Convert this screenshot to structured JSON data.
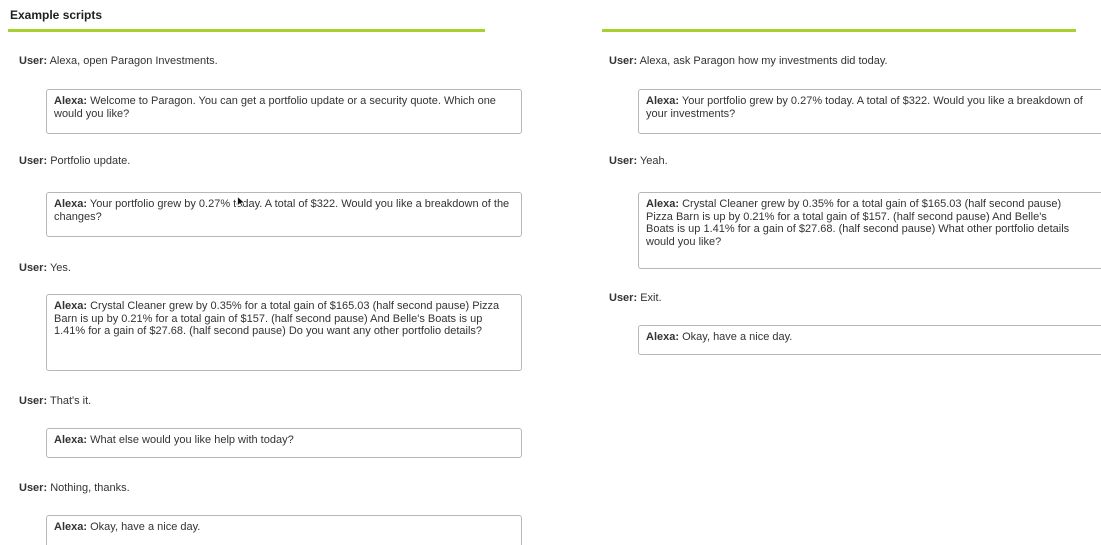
{
  "page": {
    "title": "Example scripts",
    "accent_color": "#a6d12f"
  },
  "left_script": [
    {
      "speaker": "User:",
      "text": "Alexa, open Paragon Investments."
    },
    {
      "speaker": "Alexa:",
      "text": "Welcome to Paragon. You can get a portfolio update or a security quote. Which one would you like?"
    },
    {
      "speaker": "User:",
      "text": "Portfolio update."
    },
    {
      "speaker": "Alexa:",
      "text": "Your portfolio grew by 0.27% today. A total of $322. Would you like a breakdown of the changes?"
    },
    {
      "speaker": "User:",
      "text": "Yes."
    },
    {
      "speaker": "Alexa:",
      "text": "Crystal Cleaner grew by 0.35% for a total gain of $165.03 (half second pause) Pizza Barn is up by 0.21% for a total gain of $157. (half second pause) And Belle's Boats is up 1.41% for a gain of $27.68. (half second pause) Do you want any other portfolio details?"
    },
    {
      "speaker": "User:",
      "text": "That's it."
    },
    {
      "speaker": "Alexa:",
      "text": "What else would you like help with today?"
    },
    {
      "speaker": "User:",
      "text": "Nothing, thanks."
    },
    {
      "speaker": "Alexa:",
      "text": "Okay, have a nice day."
    }
  ],
  "right_script": [
    {
      "speaker": "User:",
      "text": "Alexa, ask Paragon how my investments did today."
    },
    {
      "speaker": "Alexa:",
      "text": "Your portfolio grew by 0.27% today. A total of $322. Would you like a breakdown of your investments?"
    },
    {
      "speaker": "User:",
      "text": "Yeah."
    },
    {
      "speaker": "Alexa:",
      "text": "Crystal Cleaner grew by 0.35% for a total gain of $165.03 (half second pause) Pizza Barn is up by 0.21% for a total gain of $157. (half second pause) And Belle's Boats is up 1.41% for a gain of $27.68. (half second pause) What other portfolio details would you like?"
    },
    {
      "speaker": "User:",
      "text": "Exit."
    },
    {
      "speaker": "Alexa:",
      "text": "Okay, have a nice day."
    }
  ]
}
